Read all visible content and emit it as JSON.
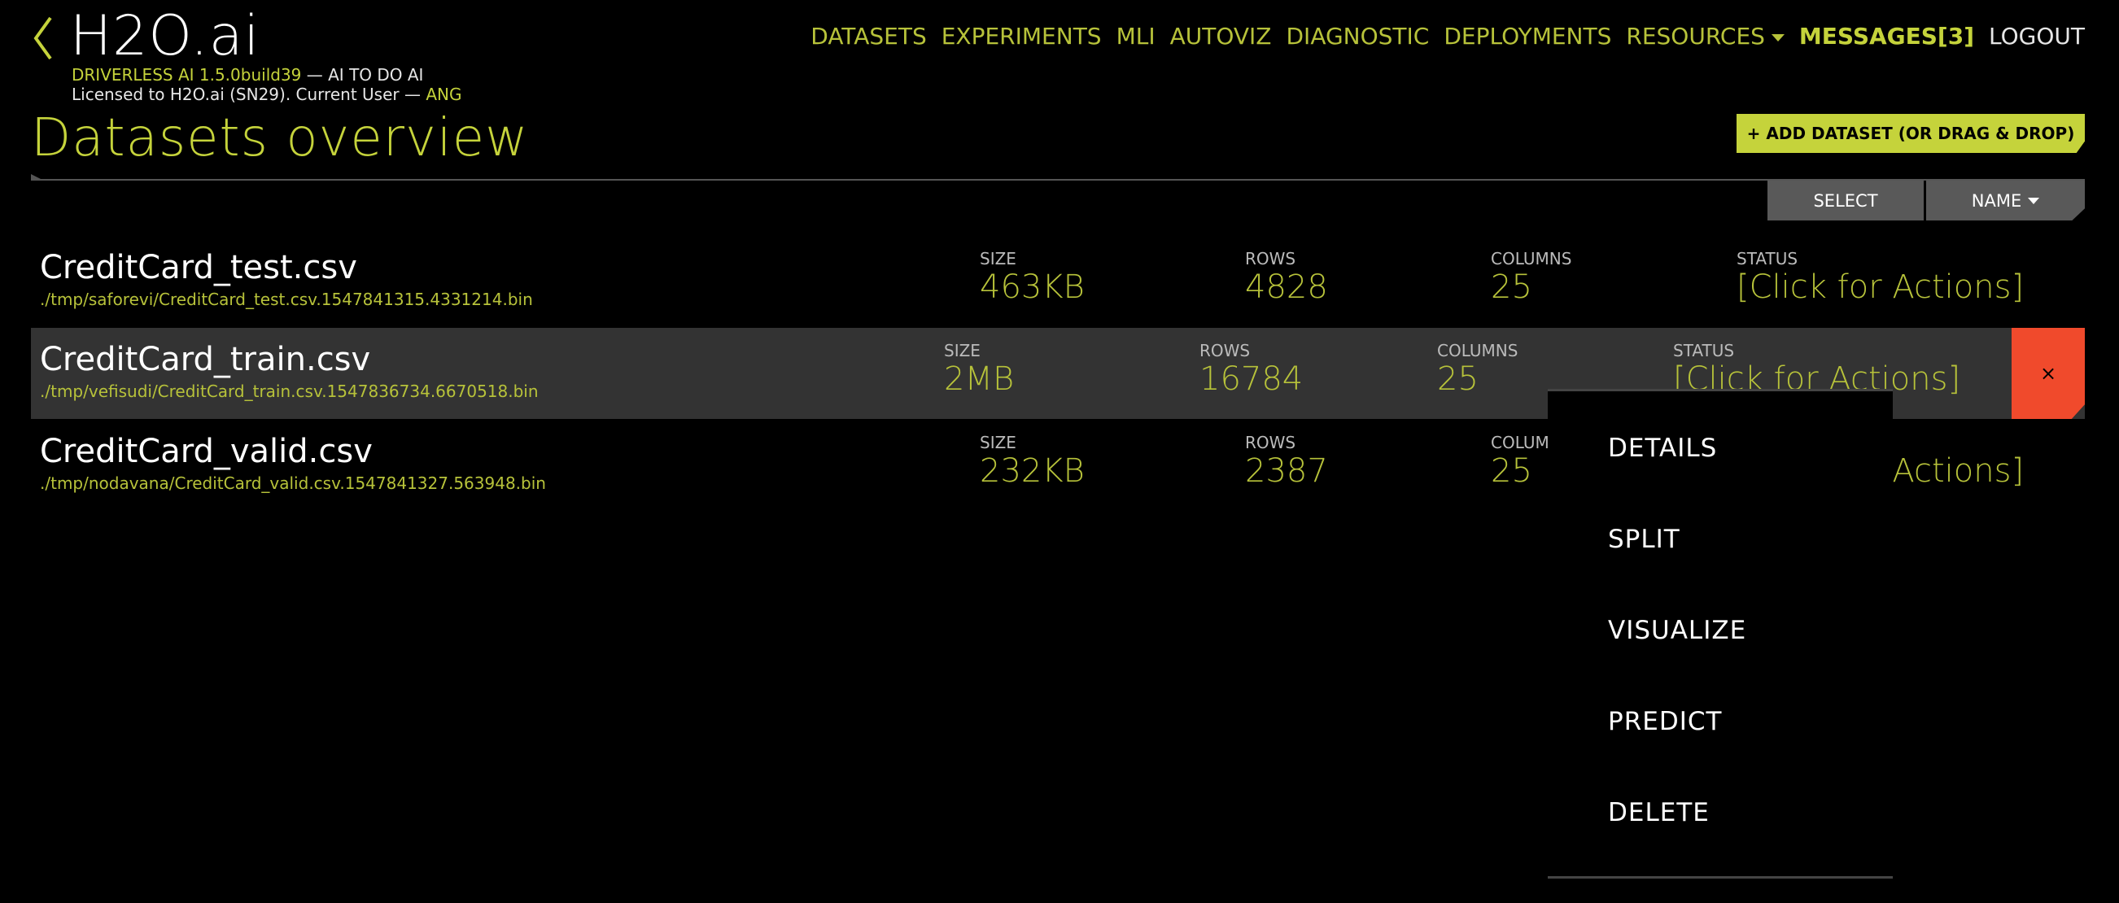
{
  "header": {
    "brand": "H2O.ai",
    "product_version": "DRIVERLESS AI 1.5.0build39",
    "tagline_sep": " — ",
    "tagline": "AI TO DO AI",
    "license_text": "Licensed to H2O.ai (SN29). Current User — ",
    "current_user": "ANG"
  },
  "nav": {
    "items": [
      "DATASETS",
      "EXPERIMENTS",
      "MLI",
      "AUTOVIZ",
      "DIAGNOSTIC",
      "DEPLOYMENTS",
      "RESOURCES"
    ],
    "messages": "MESSAGES[3]",
    "logout": "LOGOUT"
  },
  "page": {
    "title": "Datasets overview",
    "add_button": "+ ADD DATASET (OR DRAG & DROP)",
    "select_button": "SELECT",
    "sort_button": "NAME"
  },
  "labels": {
    "size": "SIZE",
    "rows": "ROWS",
    "columns": "COLUMNS",
    "status": "STATUS"
  },
  "datasets": [
    {
      "name": "CreditCard_test.csv",
      "path": "./tmp/saforevi/CreditCard_test.csv.1547841315.4331214.bin",
      "size": "463KB",
      "rows": "4828",
      "columns": "25",
      "status": "[Click for Actions]"
    },
    {
      "name": "CreditCard_train.csv",
      "path": "./tmp/vefisudi/CreditCard_train.csv.1547836734.6670518.bin",
      "size": "2MB",
      "rows": "16784",
      "columns": "25",
      "status": "[Click for Actions]"
    },
    {
      "name": "CreditCard_valid.csv",
      "path": "./tmp/nodavana/CreditCard_valid.csv.1547841327.563948.bin",
      "size": "232KB",
      "rows": "2387",
      "columns": "25",
      "status": "[Click for Actions]"
    }
  ],
  "close_symbol": "×",
  "context_menu": {
    "items": [
      "DETAILS",
      "SPLIT",
      "VISUALIZE",
      "PREDICT",
      "DELETE"
    ]
  },
  "colors": {
    "accent": "#c5d33b",
    "row_highlight": "#333333",
    "close": "#f04a2c"
  }
}
